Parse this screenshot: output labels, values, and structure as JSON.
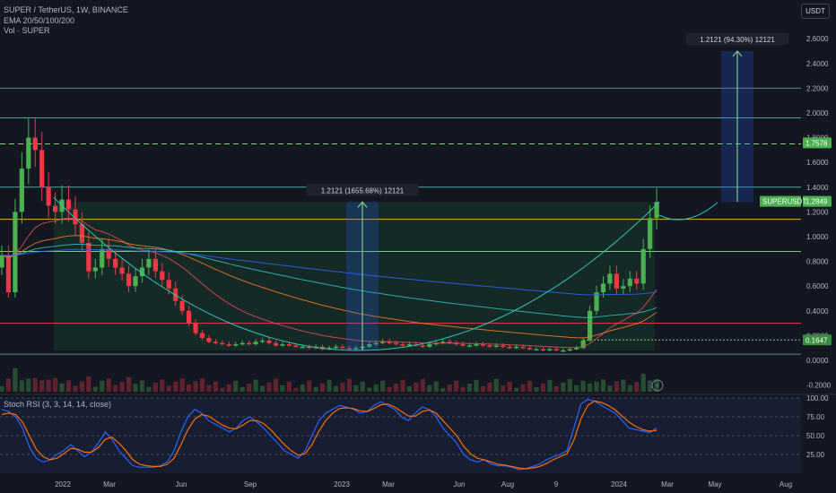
{
  "header": {
    "title": "SUPER / TetherUS, 1W, BINANCE",
    "ema_label": "EMA 20/50/100/200",
    "vol_label": "Vol · SUPER"
  },
  "currency_button": "USDT",
  "rsi_label": "Stoch RSI (3, 3, 14, 14, close)",
  "colors": {
    "background": "#131722",
    "up": "#4caf50",
    "down": "#f23645",
    "ema20": "#e64a5a",
    "ema50": "#f57c1f",
    "ema100": "#2ec4b6",
    "ema200": "#2962ff",
    "stoch_k": "#2962ff",
    "stoch_d": "#ff6d00"
  },
  "chart_data": [
    {
      "type": "candlestick",
      "title": "SUPER / TetherUS, 1W, BINANCE",
      "y_axis_ticks": [
        "2.6000",
        "2.4000",
        "2.2000",
        "2.0000",
        "1.8000",
        "1.6000",
        "1.4000",
        "1.2000",
        "1.0000",
        "0.8000",
        "0.6000",
        "0.4000",
        "0.2000",
        "0.0000",
        "-0.2000"
      ],
      "ylim": [
        -0.2,
        2.7
      ],
      "x_axis_ticks": [
        "2022",
        "Mar",
        "Jun",
        "Sep",
        "2023",
        "Mar",
        "Jun",
        "Aug",
        "9",
        "2024",
        "Mar",
        "May",
        "Aug"
      ],
      "price_labels": [
        {
          "text": "1.7578",
          "value": 1.7578
        },
        {
          "text": "1.2849",
          "value": 1.2849
        },
        {
          "text": "SUPERUSDT",
          "value": 1.2849
        },
        {
          "text": "0.1647",
          "value": 0.1647
        }
      ],
      "horizontal_levels": [
        2.2,
        1.96,
        1.75,
        1.4,
        1.14,
        0.88,
        0.3,
        0.05
      ],
      "measure_annotations": [
        "1.2121 (1655.68%) 12121",
        "1.2121 (94.30%) 12121"
      ],
      "closes": [
        0.85,
        0.55,
        1.2,
        1.55,
        1.8,
        1.7,
        1.4,
        1.25,
        1.2,
        1.3,
        1.22,
        1.1,
        0.95,
        0.72,
        0.75,
        0.9,
        0.82,
        0.75,
        0.7,
        0.6,
        0.68,
        0.75,
        0.82,
        0.72,
        0.65,
        0.58,
        0.48,
        0.4,
        0.3,
        0.22,
        0.18,
        0.15,
        0.14,
        0.13,
        0.12,
        0.13,
        0.14,
        0.13,
        0.15,
        0.16,
        0.14,
        0.12,
        0.13,
        0.12,
        0.11,
        0.11,
        0.1,
        0.11,
        0.09,
        0.1,
        0.11,
        0.1,
        0.09,
        0.1,
        0.11,
        0.13,
        0.14,
        0.15,
        0.14,
        0.13,
        0.12,
        0.13,
        0.12,
        0.11,
        0.13,
        0.14,
        0.15,
        0.14,
        0.13,
        0.12,
        0.12,
        0.13,
        0.12,
        0.11,
        0.12,
        0.11,
        0.1,
        0.11,
        0.1,
        0.09,
        0.09,
        0.08,
        0.09,
        0.08,
        0.08,
        0.09,
        0.1,
        0.16,
        0.4,
        0.55,
        0.62,
        0.7,
        0.58,
        0.6,
        0.66,
        0.62,
        0.9,
        1.15,
        1.28
      ],
      "ema20_note": "moving averages drawn",
      "stoch_rsi": {
        "levels": [
          "100.00",
          "75.00",
          "50.00",
          "25.00"
        ],
        "k": [
          85,
          82,
          75,
          60,
          35,
          20,
          15,
          18,
          25,
          30,
          38,
          30,
          22,
          28,
          40,
          55,
          45,
          30,
          20,
          10,
          8,
          8,
          8,
          10,
          15,
          30,
          55,
          75,
          85,
          80,
          70,
          65,
          60,
          55,
          60,
          70,
          75,
          68,
          60,
          50,
          40,
          30,
          25,
          20,
          30,
          50,
          70,
          80,
          85,
          90,
          88,
          85,
          80,
          82,
          90,
          95,
          90,
          85,
          75,
          70,
          80,
          88,
          85,
          75,
          60,
          50,
          40,
          25,
          18,
          15,
          18,
          12,
          10,
          10,
          8,
          5,
          6,
          9,
          12,
          18,
          22,
          25,
          30,
          60,
          92,
          98,
          96,
          90,
          85,
          80,
          70,
          60,
          58,
          56,
          54,
          60
        ],
        "d": [
          78,
          80,
          78,
          68,
          50,
          32,
          22,
          18,
          20,
          26,
          33,
          32,
          28,
          28,
          34,
          45,
          48,
          40,
          30,
          18,
          12,
          10,
          9,
          9,
          12,
          20,
          38,
          58,
          72,
          78,
          76,
          70,
          64,
          60,
          59,
          64,
          70,
          70,
          66,
          58,
          48,
          38,
          30,
          24,
          26,
          38,
          56,
          70,
          80,
          86,
          87,
          86,
          83,
          82,
          86,
          91,
          92,
          88,
          82,
          76,
          76,
          82,
          84,
          80,
          70,
          60,
          50,
          36,
          26,
          20,
          18,
          15,
          12,
          11,
          9,
          7,
          6,
          7,
          9,
          13,
          18,
          22,
          26,
          44,
          72,
          90,
          96,
          94,
          90,
          84,
          76,
          68,
          62,
          58,
          56,
          57
        ]
      }
    }
  ]
}
